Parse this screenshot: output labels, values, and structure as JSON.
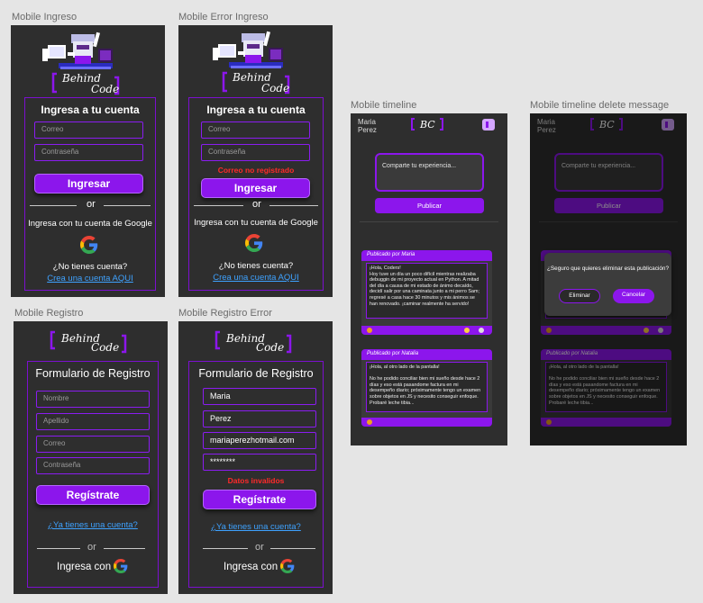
{
  "frames": {
    "mobile_ingreso": "Mobile Ingreso",
    "mobile_error_ingreso": "Mobile Error Ingreso",
    "mobile_timeline": "Mobile timeline",
    "mobile_timeline_delete": "Mobile timeline delete message",
    "mobile_registro": "Mobile Registro",
    "mobile_registro_error": "Mobile Registro Error"
  },
  "logo": {
    "line1": "Behind",
    "line2": "Code",
    "short": "BC"
  },
  "login": {
    "title": "Ingresa a tu cuenta",
    "email_placeholder": "Correo",
    "password_placeholder": "Contraseña",
    "submit": "Ingresar",
    "or": "or",
    "google_text": "Ingresa con tu cuenta de Google",
    "no_account": "¿No tienes cuenta?",
    "create_link": "Crea una cuenta AQUI",
    "error": "Correo no registrado"
  },
  "register": {
    "title": "Formulario de Registro",
    "name_placeholder": "Nombre",
    "surname_placeholder": "Apellido",
    "email_placeholder": "Correo",
    "password_placeholder": "Contraseña",
    "submit": "Regístrate",
    "have_account": "¿Ya tienes una cuenta?",
    "or": "or",
    "google_text": "Ingresa con",
    "error": "Datos invalidos",
    "name_value": "Maria",
    "surname_value": "Perez",
    "email_value": "mariaperezhotmail.com",
    "password_value": "********"
  },
  "timeline": {
    "user_first": "Maria",
    "user_last": "Perez",
    "compose_placeholder": "Comparte tu experiencia...",
    "publish": "Publicar",
    "posts": [
      {
        "author": "Publicado por Maria",
        "text": "¡Hola, Coders!\nHoy tuve un día un poco difícil mientras realizaba debuggin de mi proyecto actual en Python. A mitad del día a causa de mi estado de ánimo decaído, decidí salir por una caminata junto a mi perro Sam; regresé a casa hace 30 minutos y mis ánimos se han renovado. ¡caminar realmente ha servido!"
      },
      {
        "author": "Publicado por Natalia",
        "text": "¡Hola, al otro lado de la pantalla!\n\nNo he podido conciliar bien mi sueño desde hace 2 días y eso está pasandome factura en mi desempeño diario; próximamente tengo un examen sobre objetos en JS y necesito conseguir enfoque. Probaré leche tibia..."
      }
    ],
    "delete_question": "¿Seguro que quieres eliminar esta publicación?",
    "delete_button": "Eliminar",
    "cancel_button": "Cancelar"
  },
  "colors": {
    "accent": "#8c16ec",
    "frame_bg": "#2e2e2e",
    "error": "#ff2a2a",
    "link": "#3ea2ff"
  }
}
